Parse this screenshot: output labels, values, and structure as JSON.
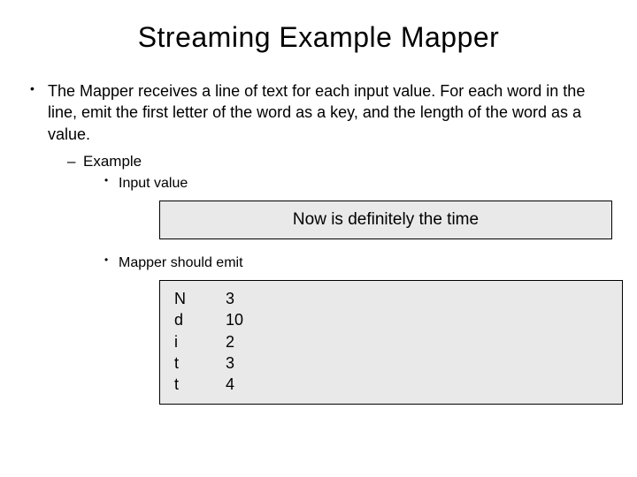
{
  "title": "Streaming Example Mapper",
  "bullet_main": "The Mapper receives a line of text for each input value. For each word in the line, emit the first letter of the word as a key, and the length of the word as a value.",
  "sub_example_label": "Example",
  "sub_input_label": "Input value",
  "input_value": "Now is definitely the time",
  "sub_emit_label": "Mapper should emit",
  "output_pairs": [
    {
      "key": "N",
      "value": "3"
    },
    {
      "key": "d",
      "value": "10"
    },
    {
      "key": "i",
      "value": "2"
    },
    {
      "key": "t",
      "value": "3"
    },
    {
      "key": "t",
      "value": "4"
    }
  ]
}
